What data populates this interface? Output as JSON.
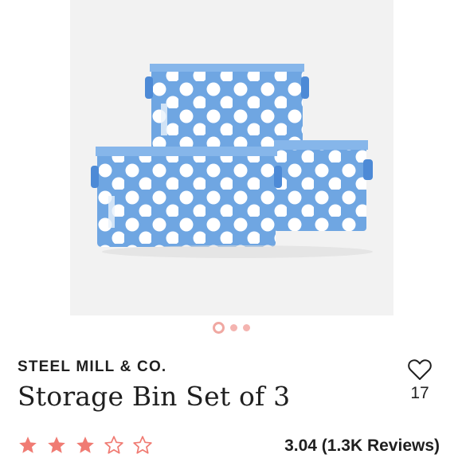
{
  "product": {
    "brand": "STEEL MILL & CO.",
    "title": "Storage Bin Set of 3",
    "favorite_count": "17",
    "rating_value": 3.04,
    "rating_text": "3.04 (1.3K Reviews)",
    "stars_filled": 3,
    "stars_total": 5
  },
  "carousel": {
    "total_images": 3,
    "active_index": 0
  },
  "colors": {
    "star_color": "#f07b73",
    "bin_blue": "#6fa6e2",
    "polka_dot": "#ffffff",
    "dot_active": "#f0a8a2"
  },
  "icons": {
    "favorite": "heart-outline-icon",
    "star_filled": "star-filled-icon",
    "star_empty": "star-outline-icon"
  }
}
